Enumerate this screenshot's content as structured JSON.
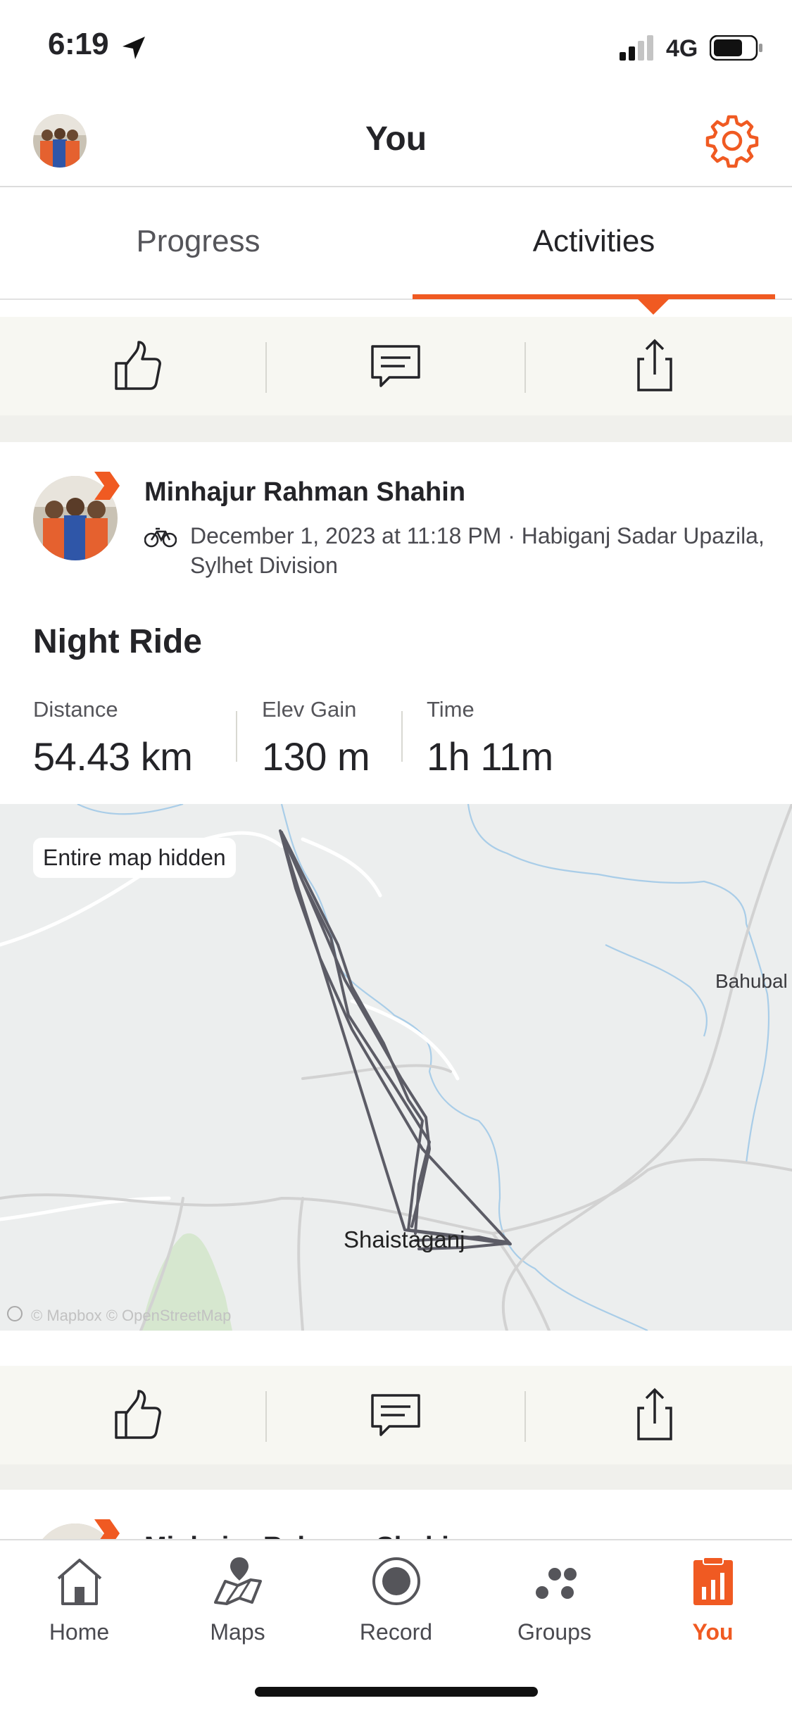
{
  "status_bar": {
    "time": "6:19",
    "network": "4G"
  },
  "header": {
    "title": "You"
  },
  "tabs": [
    {
      "label": "Progress"
    },
    {
      "label": "Activities"
    }
  ],
  "activity": {
    "athlete_name": "Minhajur Rahman Shahin",
    "meta": "December 1, 2023 at 11:18 PM · Habiganj Sadar Upazila, Sylhet Division",
    "title": "Night Ride",
    "stats": [
      {
        "label": "Distance",
        "value": "54.43 km"
      },
      {
        "label": "Elev Gain",
        "value": "130 m"
      },
      {
        "label": "Time",
        "value": "1h 11m"
      }
    ],
    "map": {
      "privacy_label": "Entire map hidden",
      "places": {
        "bahubal": "Bahubal",
        "shaistaganj": "Shaistaganj"
      },
      "attribution": "© Mapbox © OpenStreetMap"
    }
  },
  "next_activity": {
    "athlete_name": "Minhajur Rahman Shahin"
  },
  "bottom_nav": [
    {
      "label": "Home",
      "icon": "home-icon"
    },
    {
      "label": "Maps",
      "icon": "maps-icon"
    },
    {
      "label": "Record",
      "icon": "record-icon"
    },
    {
      "label": "Groups",
      "icon": "groups-icon"
    },
    {
      "label": "You",
      "icon": "you-icon",
      "active": true
    }
  ],
  "colors": {
    "accent": "#f05a22",
    "text": "#242428",
    "route": "#5c5c66"
  }
}
